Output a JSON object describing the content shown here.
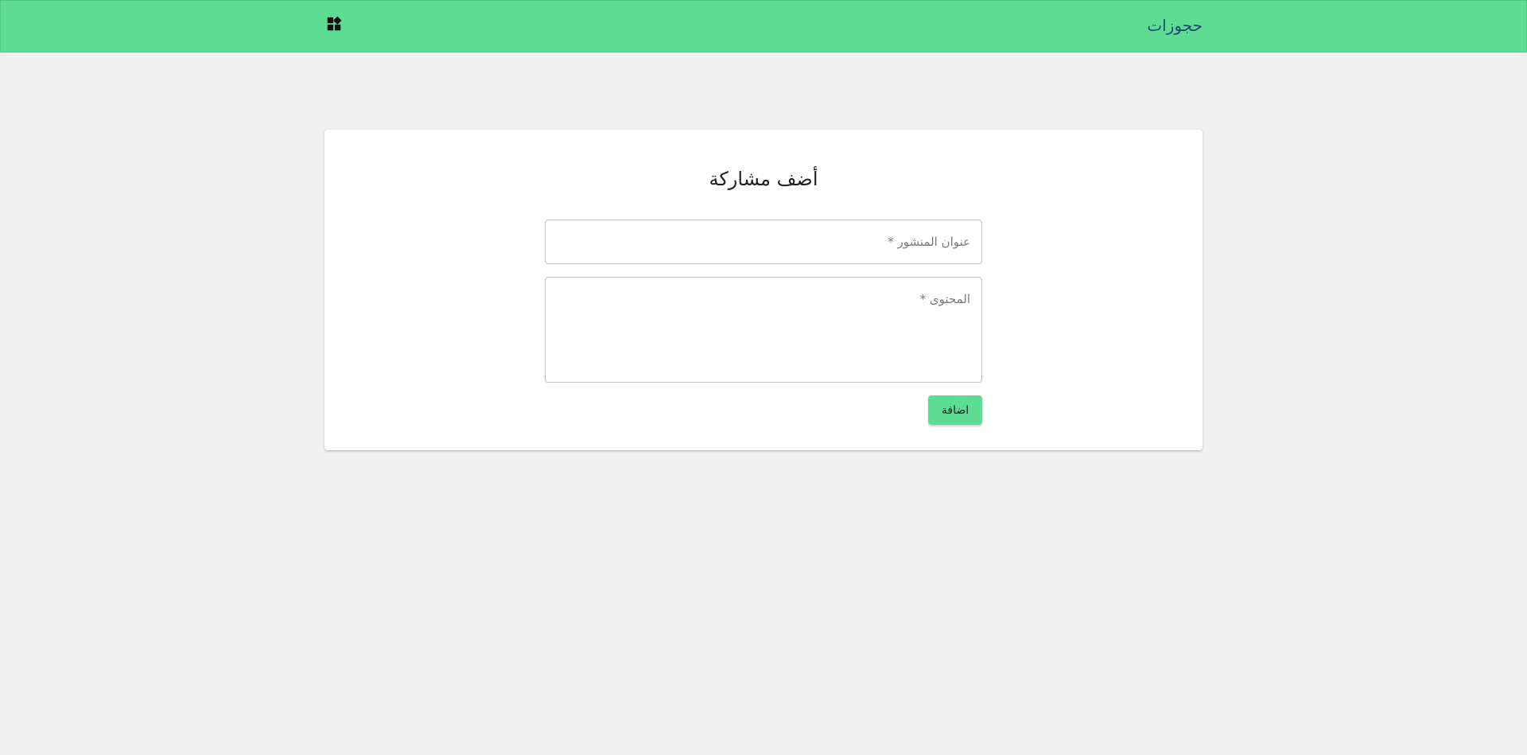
{
  "header": {
    "brand": "حجوزات",
    "widgets_icon": "widgets-icon",
    "background_color": "#5ddd94"
  },
  "form": {
    "title": "أضف مشاركة",
    "post_title_placeholder": "عنوان المنشور *",
    "post_title_value": "",
    "content_placeholder": "المحتوى *",
    "content_value": "",
    "submit_label": "اضافة",
    "accent_color": "#5ddd94"
  }
}
